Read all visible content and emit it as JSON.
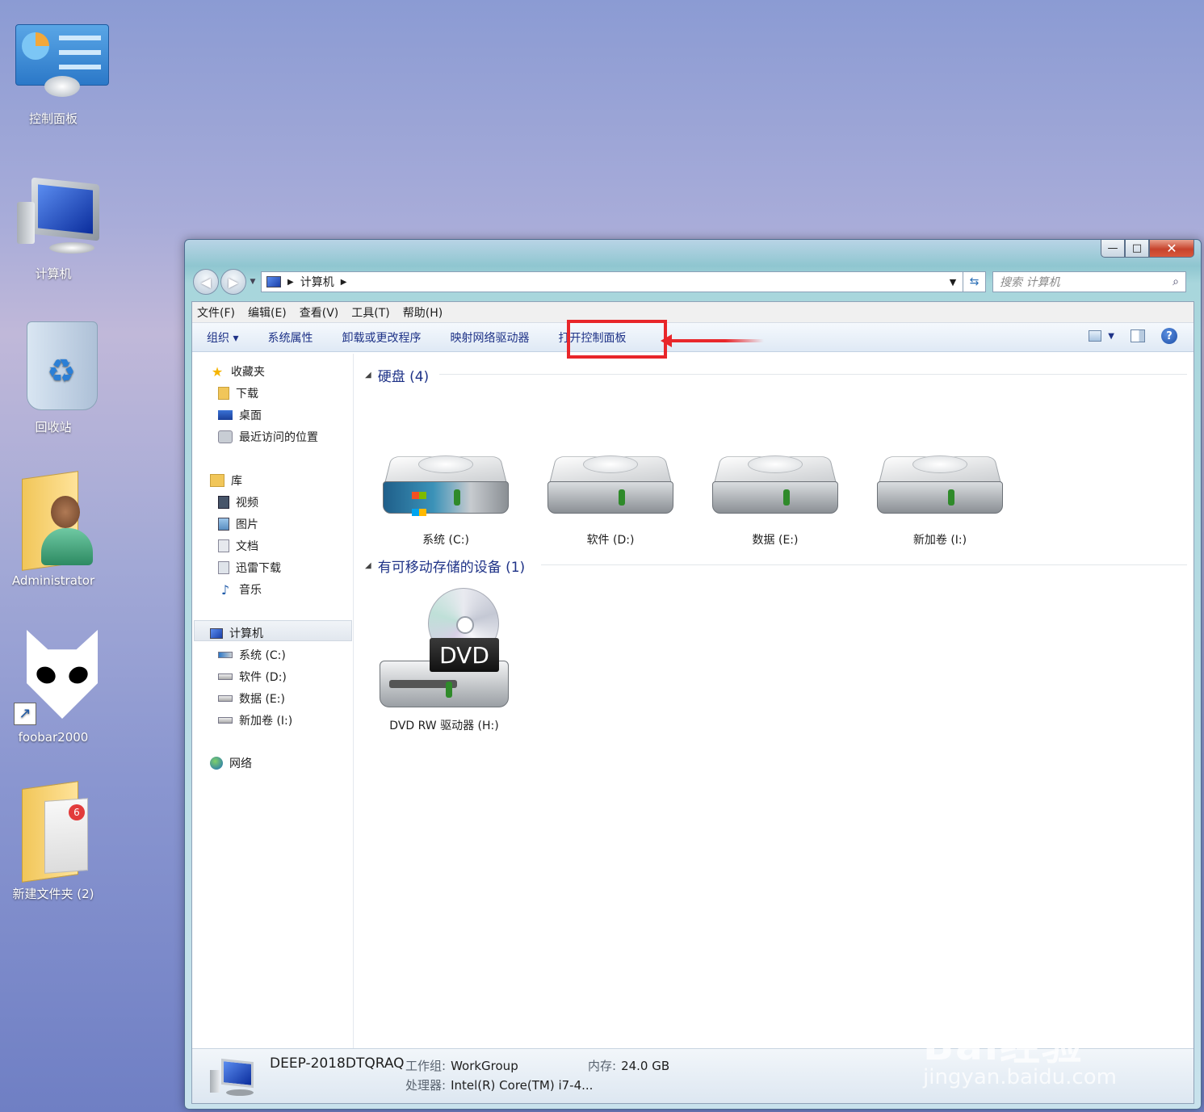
{
  "desktop": {
    "icons": [
      {
        "label": "控制面板"
      },
      {
        "label": "计算机"
      },
      {
        "label": "回收站"
      },
      {
        "label": "Administrator"
      },
      {
        "label": "foobar2000"
      },
      {
        "label": "新建文件夹 (2)"
      }
    ]
  },
  "window": {
    "controls": {
      "minimize": "—",
      "maximize": "□",
      "close": "✕"
    },
    "address": {
      "crumb": "计算机"
    },
    "search": {
      "placeholder": "搜索 计算机"
    },
    "menubar": [
      "文件(F)",
      "编辑(E)",
      "查看(V)",
      "工具(T)",
      "帮助(H)"
    ],
    "toolbar": {
      "organize": "组织 ▾",
      "system_properties": "系统属性",
      "uninstall": "卸载或更改程序",
      "map_drive": "映射网络驱动器",
      "open_control_panel": "打开控制面板"
    },
    "sidebar": {
      "favorites": "收藏夹",
      "downloads": "下载",
      "desktop": "桌面",
      "recent": "最近访问的位置",
      "libraries": "库",
      "videos": "视频",
      "pictures": "图片",
      "documents": "文档",
      "thunder": "迅雷下载",
      "music": "音乐",
      "computer": "计算机",
      "drive_c": "系统 (C:)",
      "drive_d": "软件 (D:)",
      "drive_e": "数据 (E:)",
      "drive_i": "新加卷 (I:)",
      "network": "网络"
    },
    "groups": {
      "hard_disks": "硬盘 (4)",
      "removable": "有可移动存储的设备 (1)"
    },
    "drives": {
      "c": "系统 (C:)",
      "d": "软件 (D:)",
      "e": "数据 (E:)",
      "i": "新加卷 (I:)",
      "h": "DVD RW 驱动器 (H:)",
      "dvd_label": "DVD"
    },
    "details": {
      "name": "DEEP-2018DTQRAQ",
      "workgroup_label": "工作组:",
      "workgroup": "WorkGroup",
      "memory_label": "内存:",
      "memory": "24.0 GB",
      "processor_label": "处理器:",
      "processor": "Intel(R) Core(TM) i7-4..."
    }
  },
  "watermark": {
    "main": "Bai经验",
    "sub": "jingyan.baidu.com"
  },
  "colors": {
    "highlight": "#e8262a",
    "link": "#1e3287"
  }
}
